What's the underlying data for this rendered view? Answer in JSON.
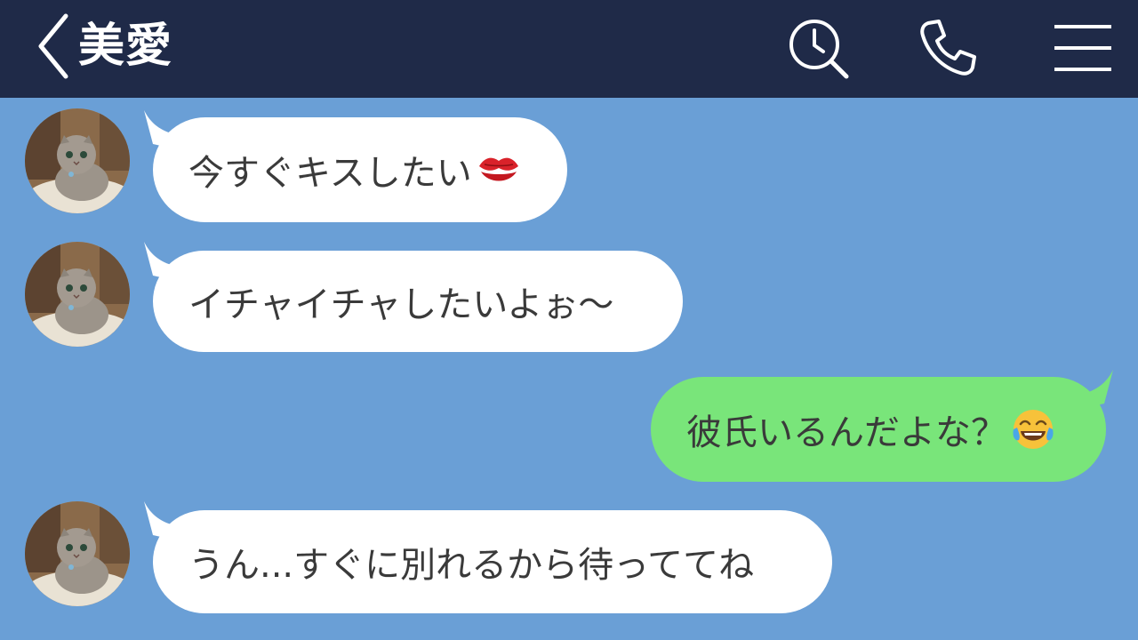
{
  "header": {
    "contact_name": "美愛",
    "back_icon": "chevron-left-icon",
    "search_icon": "search-clock-icon",
    "call_icon": "phone-icon",
    "menu_icon": "hamburger-menu-icon",
    "background_color": "#1f2a48"
  },
  "chat": {
    "background_color": "#6a9fd6",
    "incoming_bubble_color": "#ffffff",
    "outgoing_bubble_color": "#79e57a",
    "messages": [
      {
        "direction": "incoming",
        "text": "今すぐキスしたい",
        "emoji": "kiss-mark-icon"
      },
      {
        "direction": "incoming",
        "text": "イチャイチャしたいよぉ〜",
        "emoji": ""
      },
      {
        "direction": "outgoing",
        "text": "彼氏いるんだよな？",
        "emoji": "tears-of-joy-icon"
      },
      {
        "direction": "incoming",
        "text": "うん...すぐに別れるから待っててね",
        "emoji": ""
      }
    ],
    "avatar_icon": "kitten-avatar-icon"
  }
}
